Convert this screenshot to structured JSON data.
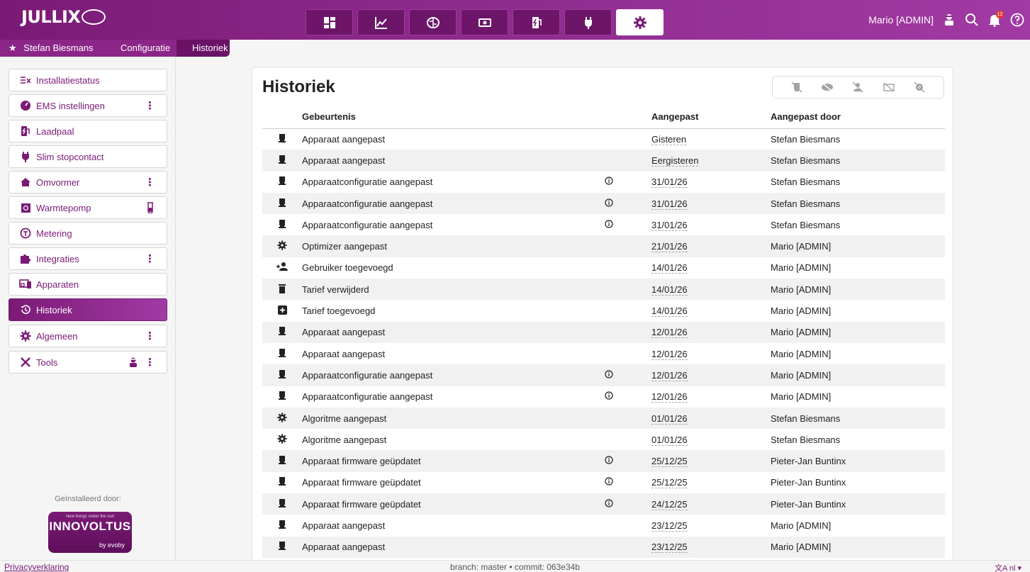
{
  "app": {
    "logo_text": "JULLIX"
  },
  "nav": {
    "tabs": [
      {
        "icon": "dashboard-icon"
      },
      {
        "icon": "chart-icon"
      },
      {
        "icon": "brain-icon"
      },
      {
        "icon": "money-icon"
      },
      {
        "icon": "charger-icon"
      },
      {
        "icon": "plug-icon"
      },
      {
        "icon": "gear-icon",
        "active": true
      }
    ]
  },
  "user": {
    "name": "Mario [ADMIN]",
    "notifications": "12"
  },
  "breadcrumb": {
    "home": "Stefan Biesmans",
    "section": "Configuratie",
    "current": "Historiek"
  },
  "sidebar": {
    "items": [
      {
        "label": "Installatiestatus",
        "icon": "checklist-icon"
      },
      {
        "label": "EMS instellingen",
        "icon": "gauge-icon",
        "menu": true
      },
      {
        "label": "Laadpaal",
        "icon": "charger-icon"
      },
      {
        "label": "Slim stopcontact",
        "icon": "plug-icon"
      },
      {
        "label": "Omvormer",
        "icon": "home-icon",
        "menu": true
      },
      {
        "label": "Warmtepomp",
        "icon": "heatpump-icon",
        "extra": "flask-icon"
      },
      {
        "label": "Metering",
        "icon": "meter-icon"
      },
      {
        "label": "Integraties",
        "icon": "puzzle-icon",
        "menu": true
      },
      {
        "label": "Apparaten",
        "icon": "devices-icon"
      },
      {
        "label": "Historiek",
        "icon": "history-icon",
        "active": true
      },
      {
        "label": "Algemeen",
        "icon": "gear-icon",
        "menu": true
      },
      {
        "label": "Tools",
        "icon": "tools-icon",
        "menu": true,
        "extra": "admin-icon"
      }
    ],
    "installed_by": "Geïnstalleerd door:",
    "installer": {
      "tagline": "New things under the sun",
      "name": "INNOVOLTUS",
      "by": "by",
      "sub": "evoby"
    }
  },
  "history": {
    "title": "Historiek",
    "columns": {
      "event": "Gebeurtenis",
      "modified": "Aangepast",
      "modified_by": "Aangepast door"
    },
    "rows": [
      {
        "icon": "device-icon",
        "event": "Apparaat aangepast",
        "info": false,
        "date": "Gisteren",
        "by": "Stefan Biesmans"
      },
      {
        "icon": "device-icon",
        "event": "Apparaat aangepast",
        "info": false,
        "date": "Eergisteren",
        "by": "Stefan Biesmans"
      },
      {
        "icon": "device-icon",
        "event": "Apparaatconfiguratie aangepast",
        "info": true,
        "date": "31/01/26",
        "by": "Stefan Biesmans"
      },
      {
        "icon": "device-icon",
        "event": "Apparaatconfiguratie aangepast",
        "info": true,
        "date": "31/01/26",
        "by": "Stefan Biesmans"
      },
      {
        "icon": "device-icon",
        "event": "Apparaatconfiguratie aangepast",
        "info": true,
        "date": "31/01/26",
        "by": "Stefan Biesmans"
      },
      {
        "icon": "gear-icon",
        "event": "Optimizer aangepast",
        "info": false,
        "date": "21/01/26",
        "by": "Mario [ADMIN]"
      },
      {
        "icon": "user-add-icon",
        "event": "Gebruiker toegevoegd",
        "info": false,
        "date": "14/01/26",
        "by": "Mario [ADMIN]"
      },
      {
        "icon": "trash-icon",
        "event": "Tarief verwijderd",
        "info": false,
        "date": "14/01/26",
        "by": "Mario [ADMIN]"
      },
      {
        "icon": "plus-box-icon",
        "event": "Tarief toegevoegd",
        "info": false,
        "date": "14/01/26",
        "by": "Mario [ADMIN]"
      },
      {
        "icon": "device-icon",
        "event": "Apparaat aangepast",
        "info": false,
        "date": "12/01/26",
        "by": "Mario [ADMIN]"
      },
      {
        "icon": "device-icon",
        "event": "Apparaat aangepast",
        "info": false,
        "date": "12/01/26",
        "by": "Mario [ADMIN]"
      },
      {
        "icon": "device-icon",
        "event": "Apparaatconfiguratie aangepast",
        "info": true,
        "date": "12/01/26",
        "by": "Mario [ADMIN]"
      },
      {
        "icon": "device-icon",
        "event": "Apparaatconfiguratie aangepast",
        "info": true,
        "date": "12/01/26",
        "by": "Mario [ADMIN]"
      },
      {
        "icon": "gear-icon",
        "event": "Algoritme aangepast",
        "info": false,
        "date": "01/01/26",
        "by": "Stefan Biesmans"
      },
      {
        "icon": "gear-icon",
        "event": "Algoritme aangepast",
        "info": false,
        "date": "01/01/26",
        "by": "Stefan Biesmans"
      },
      {
        "icon": "device-icon",
        "event": "Apparaat firmware geüpdatet",
        "info": true,
        "date": "25/12/25",
        "by": "Pieter-Jan Buntinx"
      },
      {
        "icon": "device-icon",
        "event": "Apparaat firmware geüpdatet",
        "info": true,
        "date": "25/12/25",
        "by": "Pieter-Jan Buntinx"
      },
      {
        "icon": "device-icon",
        "event": "Apparaat firmware geüpdatet",
        "info": true,
        "date": "24/12/25",
        "by": "Pieter-Jan Buntinx"
      },
      {
        "icon": "device-icon",
        "event": "Apparaat aangepast",
        "info": false,
        "date": "23/12/25",
        "by": "Mario [ADMIN]"
      },
      {
        "icon": "device-icon",
        "event": "Apparaat aangepast",
        "info": false,
        "date": "23/12/25",
        "by": "Mario [ADMIN]"
      }
    ]
  },
  "footer": {
    "privacy": "Privacyverklaring",
    "commit": "branch: master • commit: 063e34b",
    "lang": "nl ▾"
  },
  "colors": {
    "brand": "#7b1a76",
    "brand_light": "#a23aa4"
  }
}
